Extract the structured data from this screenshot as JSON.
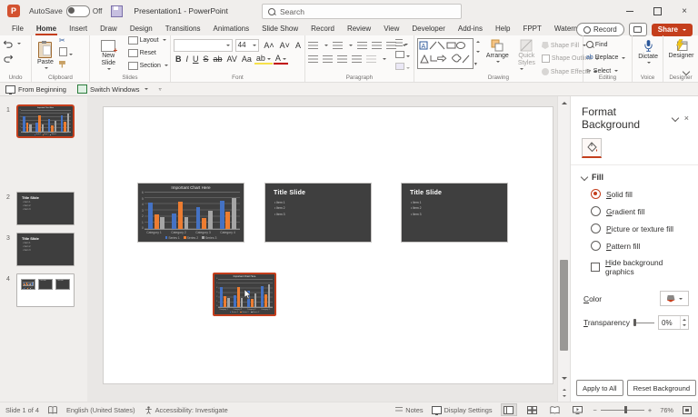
{
  "colors": {
    "accent": "#C43E1C",
    "series_blue": "#4472C4",
    "series_orange": "#ED7D31",
    "series_gray": "#A5A5A5",
    "dark_slide": "#3F3F3F"
  },
  "icons": {
    "app": "P",
    "close": "×",
    "minus": "−",
    "plus": "+"
  },
  "titlebar": {
    "autosave": "AutoSave",
    "autosave_state": "Off",
    "title": "Presentation1  -  PowerPoint",
    "search": "Search",
    "record": "Record",
    "share": "Share"
  },
  "tabs": {
    "items": [
      "File",
      "Home",
      "Insert",
      "Draw",
      "Design",
      "Transitions",
      "Animations",
      "Slide Show",
      "Record",
      "Review",
      "View",
      "Developer",
      "Add-ins",
      "Help",
      "FPPT",
      "Watermark"
    ],
    "active": "Home"
  },
  "ribbon": {
    "groups": {
      "undo": "Undo",
      "clipboard": "Clipboard",
      "slides": "Slides",
      "font": "Font",
      "paragraph": "Paragraph",
      "drawing": "Drawing",
      "editing": "Editing",
      "voice": "Voice",
      "designer": "Designer"
    },
    "paste": "Paste",
    "new_slide": "New Slide",
    "layout": "Layout",
    "reset": "Reset",
    "section": "Section",
    "font_size": "44",
    "font_row1_buttons": [
      "A˄",
      "A˅",
      "A"
    ],
    "font_buttons": [
      "B",
      "I",
      "U",
      "S",
      "ab",
      "AV",
      "Aa"
    ],
    "arrange": "Arrange",
    "quick": "Quick",
    "styles": "Styles",
    "shape_fill": "Shape Fill",
    "shape_outline": "Shape Outline",
    "shape_effects": "Shape Effects",
    "find": "Find",
    "replace": "Replace",
    "select": "Select",
    "dictate": "Dictate",
    "designer": "Designer"
  },
  "qat": {
    "from_beginning": "From Beginning",
    "switch_windows": "Switch Windows"
  },
  "slides": [
    {
      "num": "1",
      "kind": "chart",
      "selected": true
    },
    {
      "num": "2",
      "kind": "title",
      "selected": false
    },
    {
      "num": "3",
      "kind": "title",
      "selected": false
    },
    {
      "num": "4",
      "kind": "overview",
      "selected": false
    }
  ],
  "slide_text": {
    "title": "Title Slide",
    "items": [
      "Item 1",
      "Item 2",
      "Item 3"
    ]
  },
  "chart_data": {
    "type": "bar",
    "title": "Important Chart Here",
    "categories": [
      "Category 1",
      "Category 2",
      "Category 3",
      "Category 4"
    ],
    "series": [
      {
        "name": "Series 1",
        "color": "#4472C4",
        "values": [
          4.3,
          2.5,
          3.5,
          4.5
        ]
      },
      {
        "name": "Series 2",
        "color": "#ED7D31",
        "values": [
          2.4,
          4.4,
          1.8,
          2.8
        ]
      },
      {
        "name": "Series 3",
        "color": "#A5A5A5",
        "values": [
          2.0,
          2.0,
          3.0,
          5.0
        ]
      }
    ],
    "ylim": [
      0,
      6
    ],
    "yticks": [
      6,
      5,
      4,
      3,
      2,
      1,
      0
    ],
    "grid": true,
    "legend_position": "bottom"
  },
  "panel": {
    "title": "Format Background",
    "fill_section": "Fill",
    "options": [
      {
        "label": "Solid fill",
        "selected": true
      },
      {
        "label": "Gradient fill",
        "selected": false
      },
      {
        "label": "Picture or texture fill",
        "selected": false
      },
      {
        "label": "Pattern fill",
        "selected": false
      }
    ],
    "hide_bg": "Hide background graphics",
    "color_label": "Color",
    "transparency_label": "Transparency",
    "transparency_value": "0%",
    "apply_all": "Apply to All",
    "reset_bg": "Reset Background"
  },
  "statusbar": {
    "slide": "Slide 1 of 4",
    "language": "English (United States)",
    "accessibility": "Accessibility: Investigate",
    "notes": "Notes",
    "display_settings": "Display Settings",
    "zoom": "76%"
  }
}
